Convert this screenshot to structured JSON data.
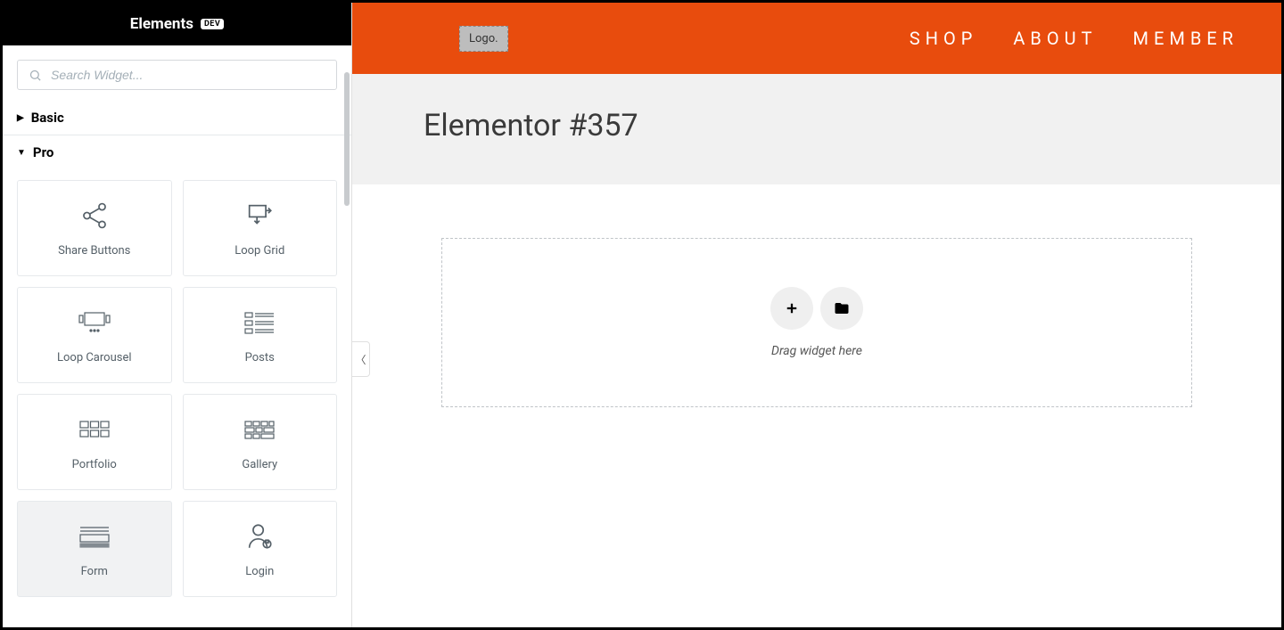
{
  "panel": {
    "title": "Elements",
    "badge": "DEV",
    "search_placeholder": "Search Widget...",
    "categories": {
      "basic": {
        "label": "Basic",
        "expanded": false
      },
      "pro": {
        "label": "Pro",
        "expanded": true
      }
    },
    "pro_widgets": [
      {
        "id": "share-buttons",
        "label": "Share Buttons"
      },
      {
        "id": "loop-grid",
        "label": "Loop Grid"
      },
      {
        "id": "loop-carousel",
        "label": "Loop Carousel"
      },
      {
        "id": "posts",
        "label": "Posts"
      },
      {
        "id": "portfolio",
        "label": "Portfolio"
      },
      {
        "id": "gallery",
        "label": "Gallery"
      },
      {
        "id": "form",
        "label": "Form"
      },
      {
        "id": "login",
        "label": "Login"
      }
    ]
  },
  "preview": {
    "logo_text": "Logo.",
    "nav": [
      "SHOP",
      "ABOUT",
      "MEMBER"
    ],
    "page_title": "Elementor #357",
    "dropzone_label": "Drag widget here"
  }
}
